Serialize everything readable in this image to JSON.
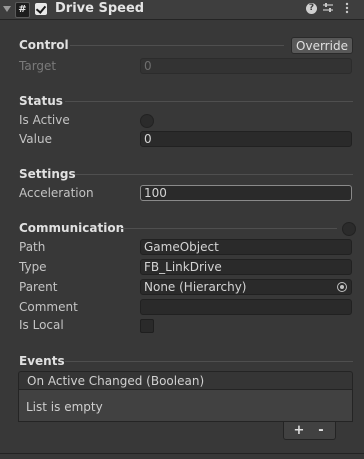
{
  "component": {
    "title": "Drive Speed",
    "script_icon_glyph": "#",
    "enabled": true,
    "header_icons": [
      "help-icon",
      "presets-icon",
      "menu-icon"
    ]
  },
  "sections": {
    "control": {
      "label": "Control",
      "override_label": "Override",
      "target_label": "Target",
      "target_value": "0"
    },
    "status": {
      "label": "Status",
      "is_active_label": "Is Active",
      "is_active": false,
      "value_label": "Value",
      "value_value": "0"
    },
    "settings": {
      "label": "Settings",
      "acceleration_label": "Acceleration",
      "acceleration_value": "100"
    },
    "communication": {
      "label": "Communication",
      "path_label": "Path",
      "path_value": "GameObject",
      "type_label": "Type",
      "type_value": "FB_LinkDrive",
      "parent_label": "Parent",
      "parent_value": "None (Hierarchy)",
      "comment_label": "Comment",
      "comment_value": "",
      "is_local_label": "Is Local",
      "is_local": false
    },
    "events": {
      "label": "Events",
      "list_header": "On Active Changed (Boolean)",
      "list_empty": "List is empty",
      "add_label": "+",
      "remove_label": "-"
    }
  }
}
